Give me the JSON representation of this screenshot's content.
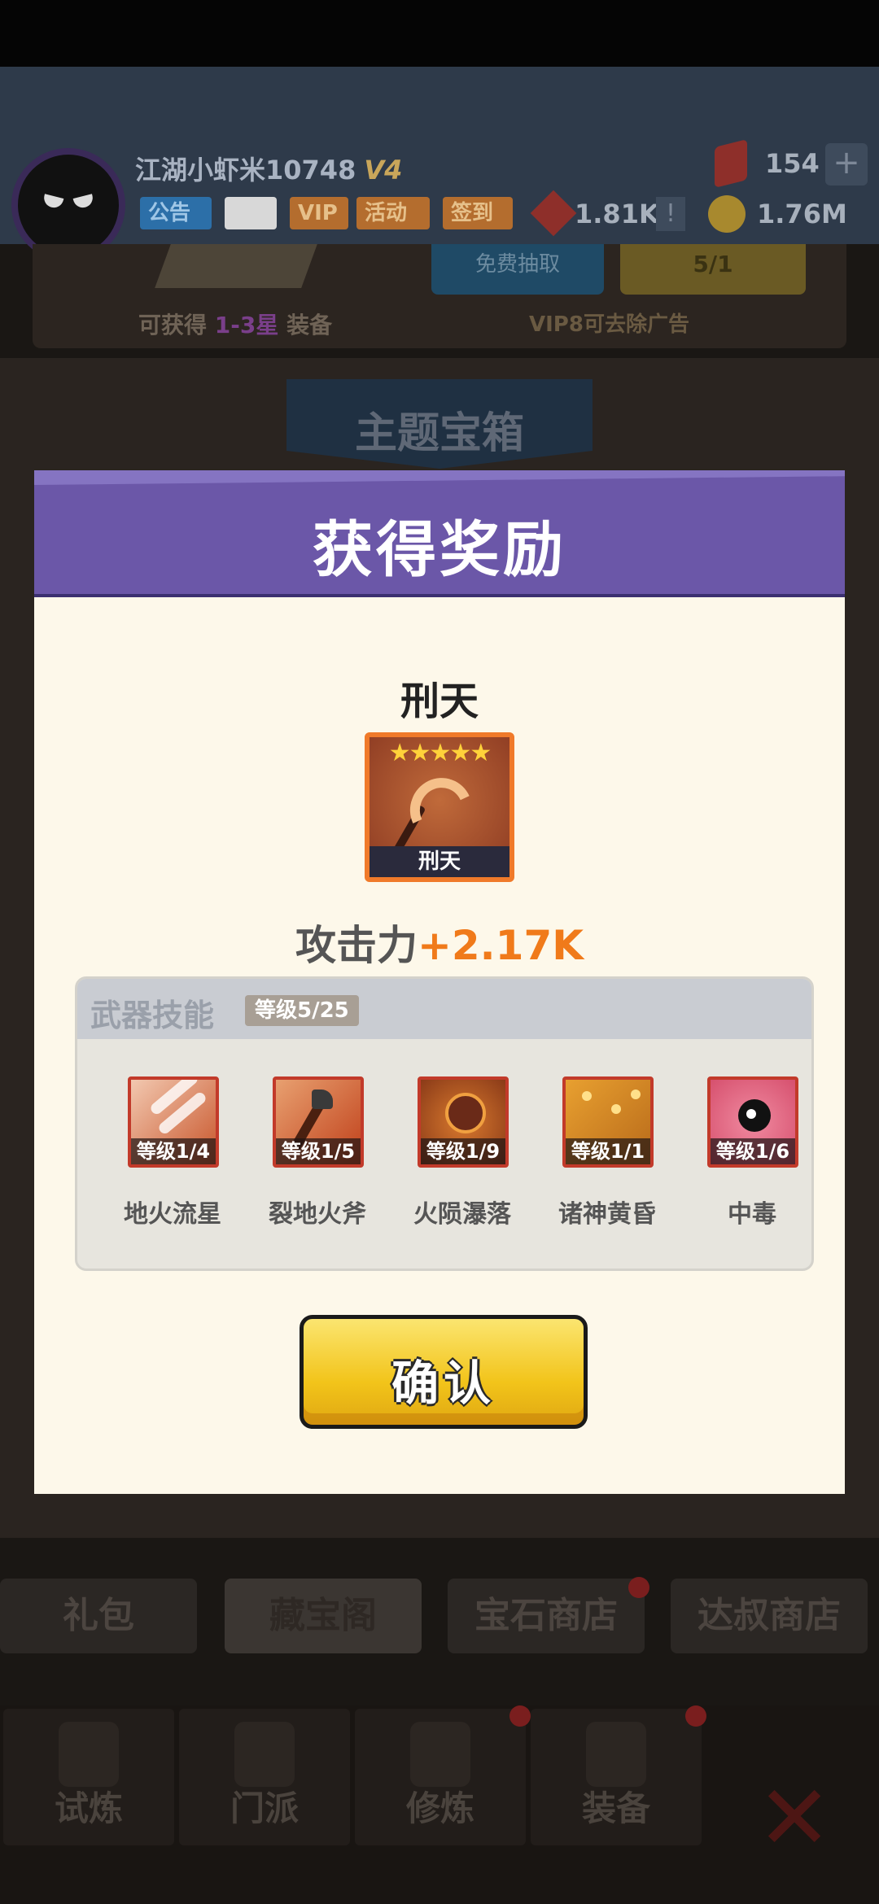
{
  "header": {
    "player_name": "江湖小虾米10748",
    "vip_level": "V4",
    "tags": {
      "notice": "公告",
      "vip": "VIP",
      "activity": "活动",
      "signin": "签到"
    },
    "resources": {
      "gems": "154",
      "red": "1.81K",
      "gold": "1.76M",
      "alert": "!"
    }
  },
  "chest": {
    "get_prefix": "可获得",
    "get_stars": "1-3星",
    "get_suffix": "装备",
    "vip_note": "VIP8可去除广告",
    "free_label": "免费抽取",
    "key_label": "5/1"
  },
  "theme_title": "主题宝箱",
  "dialog": {
    "title": "获得奖励",
    "item_name": "刑天",
    "item_stars": "★★★★★",
    "item_label": "刑天",
    "attack_label": "攻击力",
    "attack_bonus": "+2.17K",
    "skills_title": "武器技能",
    "skills_level": "等级5/25",
    "skills": [
      {
        "level": "等级1/4",
        "name": "地火流星"
      },
      {
        "level": "等级1/5",
        "name": "裂地火斧"
      },
      {
        "level": "等级1/9",
        "name": "火陨瀑落"
      },
      {
        "level": "等级1/1",
        "name": "诸神黄昏"
      },
      {
        "level": "等级1/6",
        "name": "中毒"
      }
    ],
    "confirm": "确认"
  },
  "shop_tabs": [
    "礼包",
    "藏宝阁",
    "宝石商店",
    "达叔商店"
  ],
  "nav": [
    "试炼",
    "门派",
    "修炼",
    "装备"
  ],
  "colors": {
    "dialog_header": "#6b57a8",
    "dialog_body": "#fdf8ea",
    "attack_bonus": "#f07a1a",
    "confirm_button": "#f2c41a"
  }
}
